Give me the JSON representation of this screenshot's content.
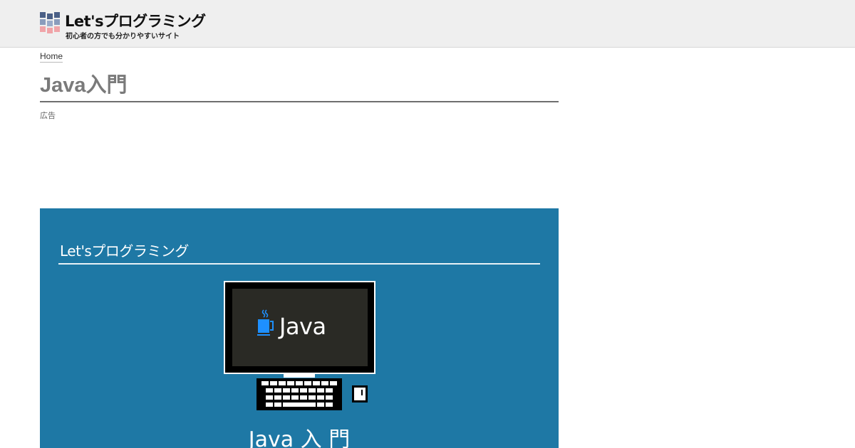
{
  "header": {
    "site_title": "Let'sプログラミング",
    "tagline": "初心者の方でも分かりやすいサイト"
  },
  "breadcrumb": {
    "home_label": "Home"
  },
  "main": {
    "page_title": "Java入門",
    "ad_label": "広告"
  },
  "hero": {
    "brand": "Let'sプログラミング",
    "screen_text": "Java",
    "caption": "Java 入 門",
    "colors": {
      "background": "#1e78a5",
      "screen": "#2a2a25",
      "java_cup": "#1e90ff"
    }
  }
}
